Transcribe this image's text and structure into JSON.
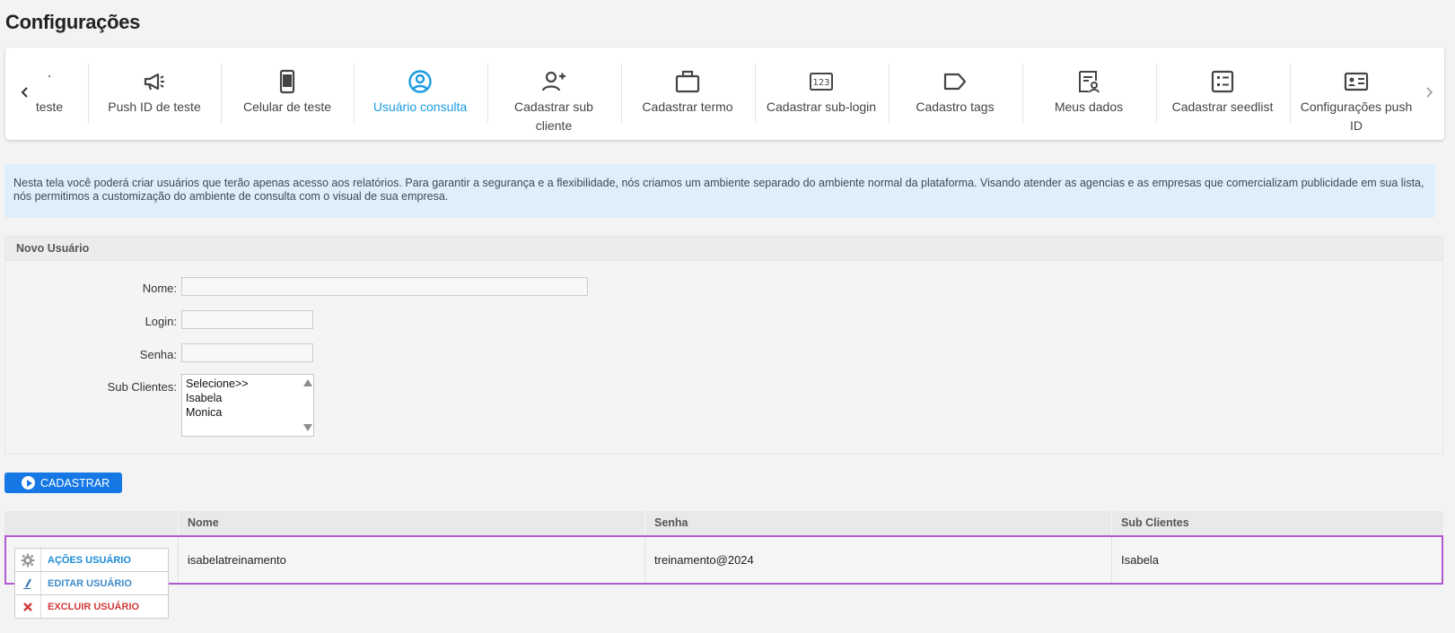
{
  "page": {
    "title": "Configurações"
  },
  "tabs": [
    {
      "label": "teste",
      "icon": "dot-icon",
      "active": false
    },
    {
      "label": "Push ID de teste",
      "icon": "megaphone-icon",
      "active": false
    },
    {
      "label": "Celular de teste",
      "icon": "phone-icon",
      "active": false
    },
    {
      "label": "Usuário consulta",
      "icon": "user-circle-icon",
      "active": true
    },
    {
      "label": "Cadastrar sub cliente",
      "icon": "user-add-icon",
      "active": false
    },
    {
      "label": "Cadastrar termo",
      "icon": "briefcase-icon",
      "active": false
    },
    {
      "label": "Cadastrar sub-login",
      "icon": "numbers-123-icon",
      "active": false
    },
    {
      "label": "Cadastro tags",
      "icon": "tag-icon",
      "active": false
    },
    {
      "label": "Meus dados",
      "icon": "user-document-icon",
      "active": false
    },
    {
      "label": "Cadastrar seedlist",
      "icon": "checklist-icon",
      "active": false
    },
    {
      "label": "Configurações push ID",
      "icon": "id-card-icon",
      "active": false
    }
  ],
  "info": {
    "text": "Nesta tela você poderá criar usuários que terão apenas acesso aos relatórios. Para garantir a segurança e a flexibilidade, nós criamos um ambiente separado do ambiente normal da plataforma. Visando atender as agencias e as empresas que comercializam publicidade em sua lista, nós permitimos a customização do ambiente de consulta com o visual de sua empresa."
  },
  "form": {
    "title": "Novo Usuário",
    "name_label": "Nome:",
    "name_value": "",
    "login_label": "Login:",
    "login_value": "",
    "password_label": "Senha:",
    "password_value": "",
    "subclients_label": "Sub Clientes:",
    "subclients_options": [
      "Selecione>>",
      "Isabela",
      "Monica"
    ],
    "submit_label": "CADASTRAR"
  },
  "table": {
    "columns": [
      "",
      "Nome",
      "Senha",
      "Sub Clientes"
    ],
    "rows": [
      {
        "nome": "isabelatreinamento",
        "senha": "treinamento@2024",
        "sub_clientes": "Isabela"
      }
    ]
  },
  "row_actions": {
    "primary": "AÇÕES USUÁRIO",
    "edit": "EDITAR USUÁRIO",
    "delete": "EXCLUIR USUÁRIO"
  },
  "colors": {
    "accent": "#1a9be0",
    "button": "#1678e5",
    "row_highlight": "#b15ad0",
    "delete": "#d33a3a",
    "info_bg": "#dfeefb"
  }
}
